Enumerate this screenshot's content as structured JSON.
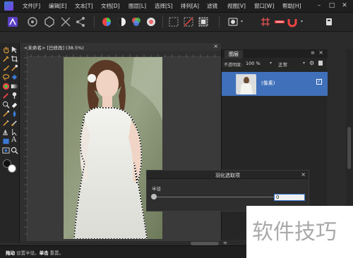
{
  "menu": {
    "items": [
      "文件[F]",
      "编辑[E]",
      "文本[T]",
      "文档[D]",
      "图层[L]",
      "选择[S]",
      "排列[A]",
      "滤镜",
      "视图[V]",
      "窗口[W]",
      "帮助[H]"
    ]
  },
  "document_tab": {
    "title": "<未命名> [已修改] (38.5%)",
    "close_glyph": "×"
  },
  "layers_panel": {
    "tab_label": "图层",
    "opacity_label": "不透明度:",
    "opacity_value": "100 %",
    "blend_mode": "正常",
    "layer_name": "(像素)"
  },
  "dialog": {
    "title": "羽化选取项",
    "close_glyph": "×",
    "radius_label": "半径",
    "radius_value": "0"
  },
  "status": {
    "drag_label": "拖动",
    "drag_text": " 设置半径。",
    "click_label": "单击",
    "click_text": " 重置。"
  },
  "watermark": {
    "text": "软件技巧"
  },
  "colors": {
    "accent": "#3f70b9",
    "selection_blue": "#3b79d3"
  }
}
